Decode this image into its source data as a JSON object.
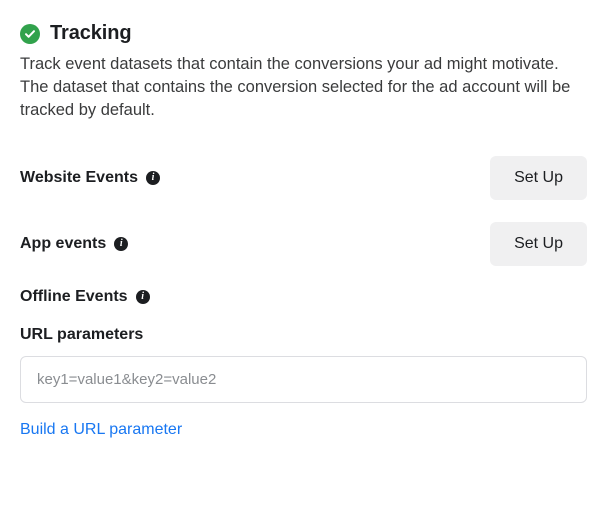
{
  "header": {
    "title": "Tracking",
    "description": "Track event datasets that contain the conversions your ad might motivate. The dataset that contains the conversion selected for the ad account will be tracked by default."
  },
  "events": {
    "website": {
      "label": "Website Events",
      "button": "Set Up"
    },
    "app": {
      "label": "App events",
      "button": "Set Up"
    },
    "offline": {
      "label": "Offline Events"
    }
  },
  "url_params": {
    "label": "URL parameters",
    "placeholder": "key1=value1&key2=value2",
    "value": "",
    "build_link": "Build a URL parameter"
  },
  "icons": {
    "info_glyph": "i"
  }
}
